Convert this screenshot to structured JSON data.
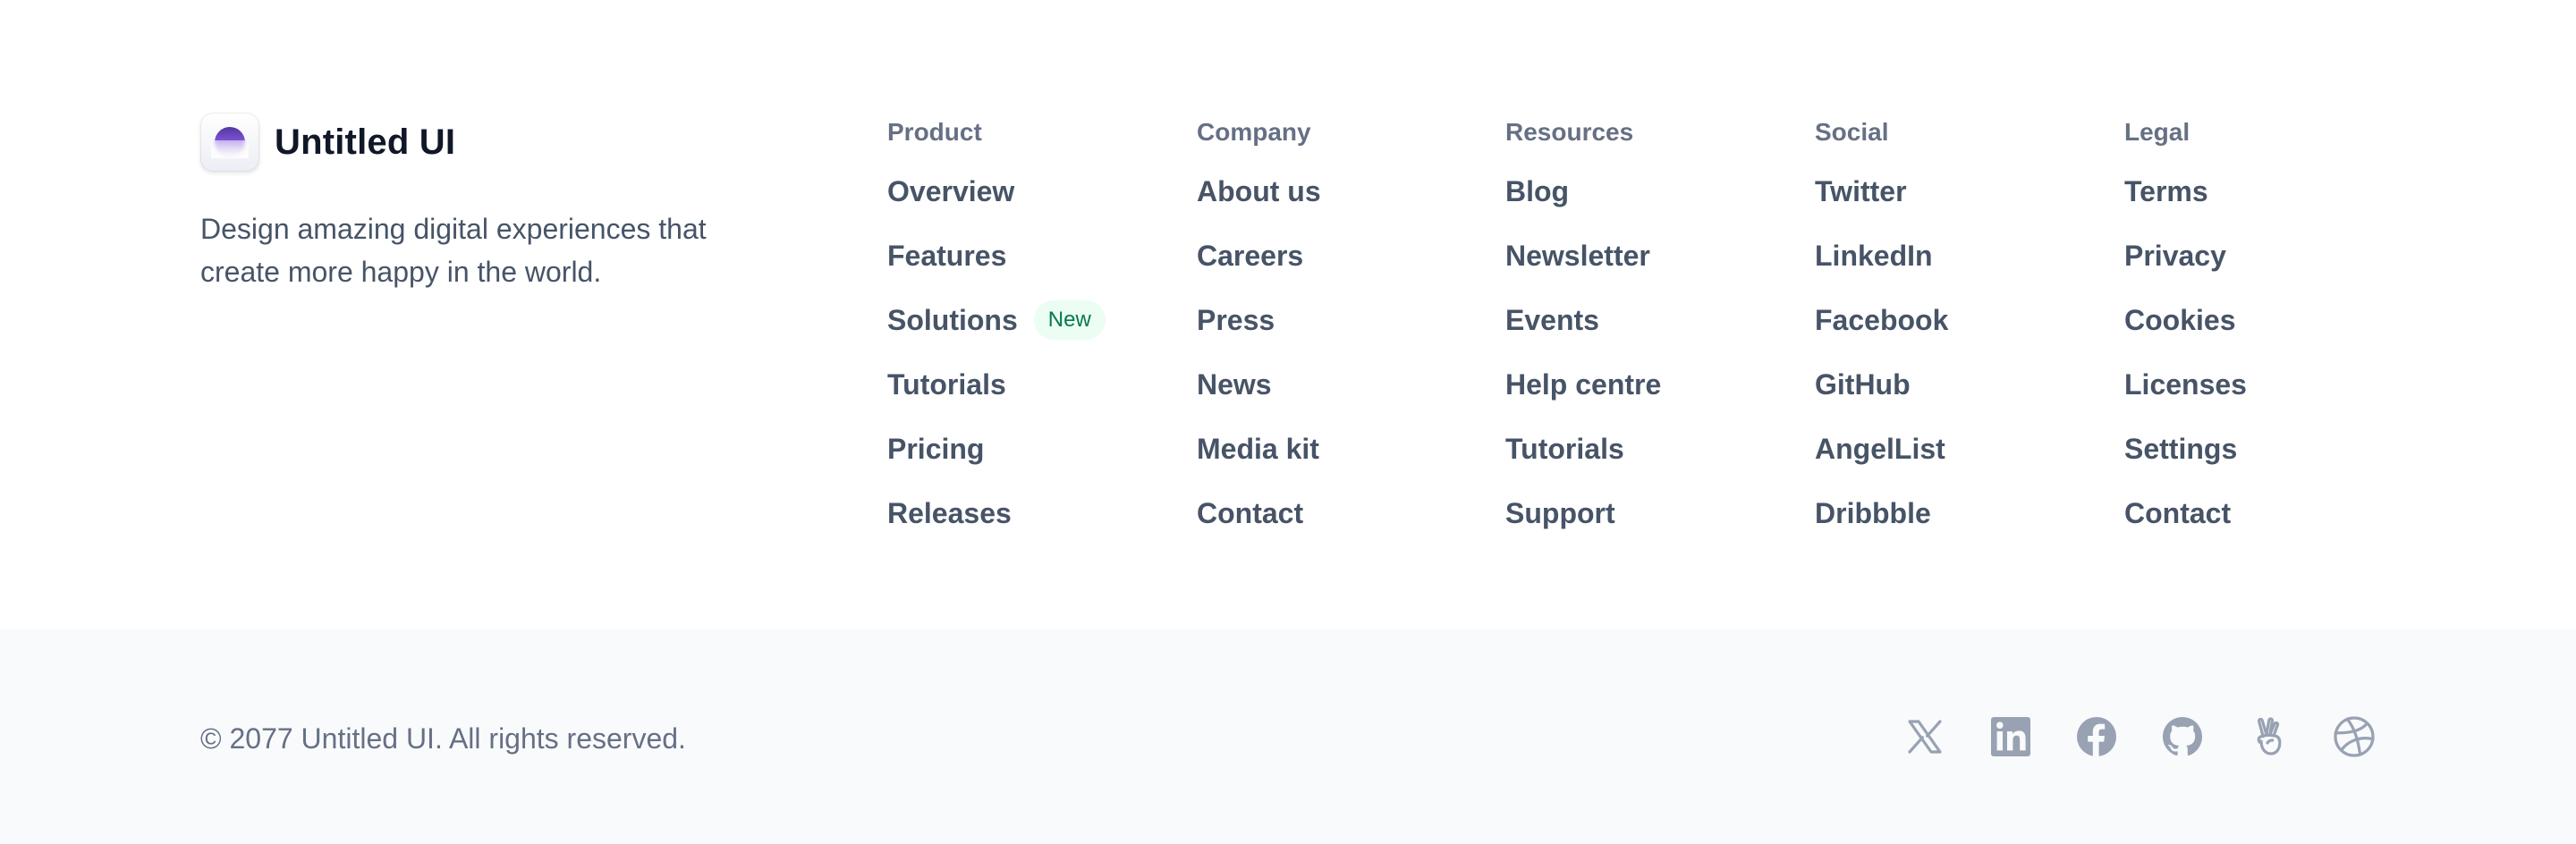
{
  "brand": {
    "name": "Untitled UI",
    "tagline": "Design amazing digital experiences that create more happy in the world."
  },
  "columns": [
    {
      "title": "Product",
      "links": [
        "Overview",
        "Features",
        "Solutions",
        "Tutorials",
        "Pricing",
        "Releases"
      ],
      "badge": {
        "index": 2,
        "label": "New"
      }
    },
    {
      "title": "Company",
      "links": [
        "About us",
        "Careers",
        "Press",
        "News",
        "Media kit",
        "Contact"
      ]
    },
    {
      "title": "Resources",
      "links": [
        "Blog",
        "Newsletter",
        "Events",
        "Help centre",
        "Tutorials",
        "Support"
      ]
    },
    {
      "title": "Social",
      "links": [
        "Twitter",
        "LinkedIn",
        "Facebook",
        "GitHub",
        "AngelList",
        "Dribbble"
      ]
    },
    {
      "title": "Legal",
      "links": [
        "Terms",
        "Privacy",
        "Cookies",
        "Licenses",
        "Settings",
        "Contact"
      ]
    }
  ],
  "footer": {
    "copyright": "© 2077 Untitled UI. All rights reserved.",
    "social_icons": [
      "x-icon",
      "linkedin-icon",
      "facebook-icon",
      "github-icon",
      "angellist-icon",
      "dribbble-icon"
    ]
  },
  "colors": {
    "text_primary": "#101828",
    "text_secondary": "#475467",
    "text_tertiary": "#667085",
    "icon_gray": "#98a2b3",
    "badge_bg": "#ecfdf3",
    "badge_text": "#027a48",
    "bottom_bg": "#f9fafb"
  }
}
